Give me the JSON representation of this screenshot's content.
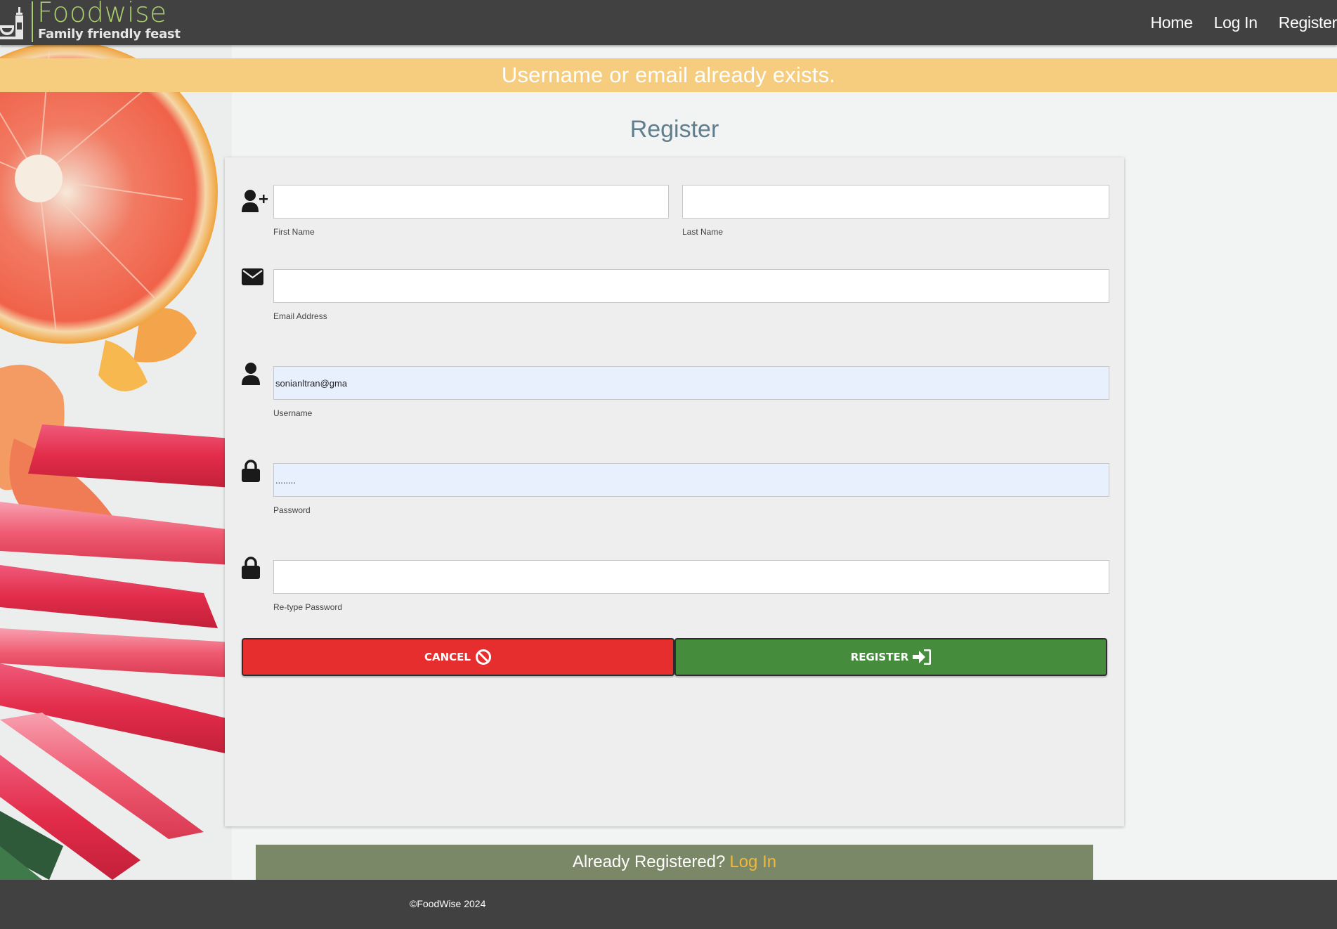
{
  "brand": {
    "name": "Foodwise",
    "tagline": "Family friendly feast"
  },
  "nav": {
    "items": [
      {
        "label": "Home"
      },
      {
        "label": "Log In"
      },
      {
        "label": "Register"
      }
    ]
  },
  "alert": {
    "message": "Username or email already exists."
  },
  "form": {
    "title": "Register",
    "first_name": {
      "label": "First Name",
      "value": ""
    },
    "last_name": {
      "label": "Last Name",
      "value": ""
    },
    "email": {
      "label": "Email Address",
      "value": ""
    },
    "username": {
      "label": "Username",
      "value": "sonianltran@gma"
    },
    "password": {
      "label": "Password",
      "value": "........"
    },
    "retype_password": {
      "label": "Re-type Password",
      "value": ""
    },
    "cancel_label": "CANCEL",
    "register_label": "REGISTER"
  },
  "login_prompt": {
    "text": "Already Registered?",
    "link": "Log In"
  },
  "footer": {
    "copyright": "©FoodWise 2024"
  },
  "colors": {
    "nav_bg": "#414141",
    "brand_green": "#a9cc6e",
    "alert_bg": "#f6cd7e",
    "title": "#5f7d8c",
    "cancel": "#e62e2f",
    "register": "#458d3d",
    "login_bar": "#7b8867",
    "login_link": "#f1b73a",
    "autofill": "#e8f0fe"
  },
  "icons": {
    "logo": "kitchen-utensils-icon",
    "first_name": "user-plus-icon",
    "email": "envelope-icon",
    "username": "user-icon",
    "password": "lock-icon",
    "retype_password": "lock-icon",
    "cancel": "ban-icon",
    "register": "sign-in-icon"
  }
}
